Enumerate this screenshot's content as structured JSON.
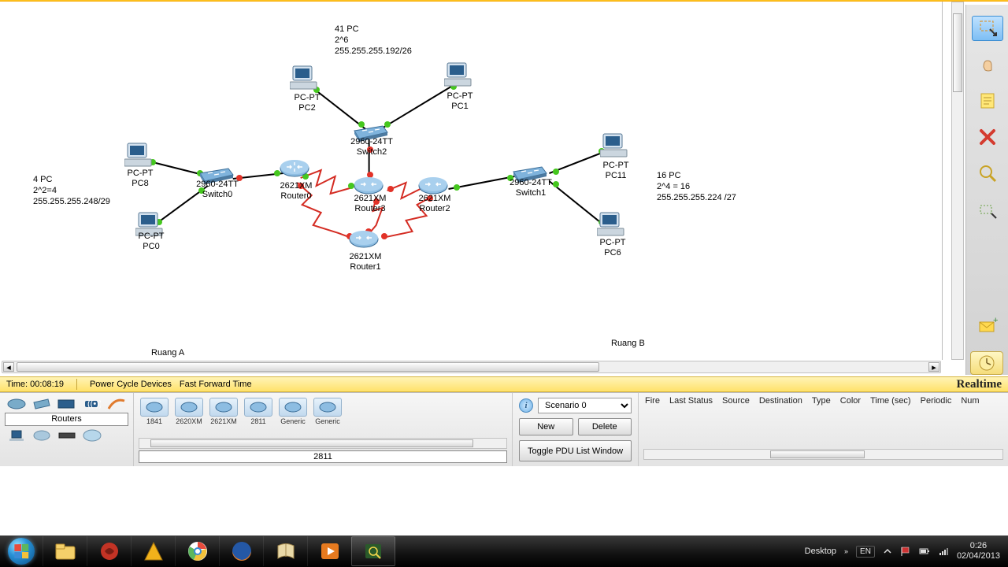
{
  "notes": {
    "top": [
      "41 PC",
      "2^6",
      "255.255.255.192/26"
    ],
    "left": [
      "4 PC",
      "2^2=4",
      "255.255.255.248/29"
    ],
    "right": [
      "16 PC",
      "2^4 = 16",
      "255.255.255.224 /27"
    ]
  },
  "areas": {
    "a": "Ruang A",
    "b": "Ruang B"
  },
  "devices": {
    "pc2": {
      "l1": "PC-PT",
      "l2": "PC2"
    },
    "pc1": {
      "l1": "PC-PT",
      "l2": "PC1"
    },
    "pc8": {
      "l1": "PC-PT",
      "l2": "PC8"
    },
    "pc0": {
      "l1": "PC-PT",
      "l2": "PC0"
    },
    "pc11": {
      "l1": "PC-PT",
      "l2": "PC11"
    },
    "pc6": {
      "l1": "PC-PT",
      "l2": "PC6"
    },
    "sw0": {
      "l1": "2960-24TT",
      "l2": "Switch0"
    },
    "sw1": {
      "l1": "2960-24TT",
      "l2": "Switch1"
    },
    "sw2": {
      "l1": "2960-24TT",
      "l2": "Switch2"
    },
    "r0": {
      "l1": "2621XM",
      "l2": "Router0"
    },
    "r1": {
      "l1": "2621XM",
      "l2": "Router1"
    },
    "r2": {
      "l1": "2621XM",
      "l2": "Router2"
    },
    "r3": {
      "l1": "2621XM",
      "l2": "Router3"
    }
  },
  "simbar": {
    "time": "Time: 00:08:19",
    "power": "Power Cycle Devices",
    "fft": "Fast Forward Time",
    "realtime": "Realtime"
  },
  "palette": {
    "category": "Routers",
    "items": [
      "1841",
      "2620XM",
      "2621XM",
      "2811",
      "Generic",
      "Generic"
    ],
    "selected": "2811"
  },
  "scenario": {
    "name": "Scenario 0",
    "new": "New",
    "delete": "Delete",
    "toggle": "Toggle PDU List Window"
  },
  "pdu_headers": [
    "Fire",
    "Last Status",
    "Source",
    "Destination",
    "Type",
    "Color",
    "Time (sec)",
    "Periodic",
    "Num"
  ],
  "tray": {
    "desktop": "Desktop",
    "lang": "EN",
    "time": "0:26",
    "date": "02/04/2013"
  }
}
